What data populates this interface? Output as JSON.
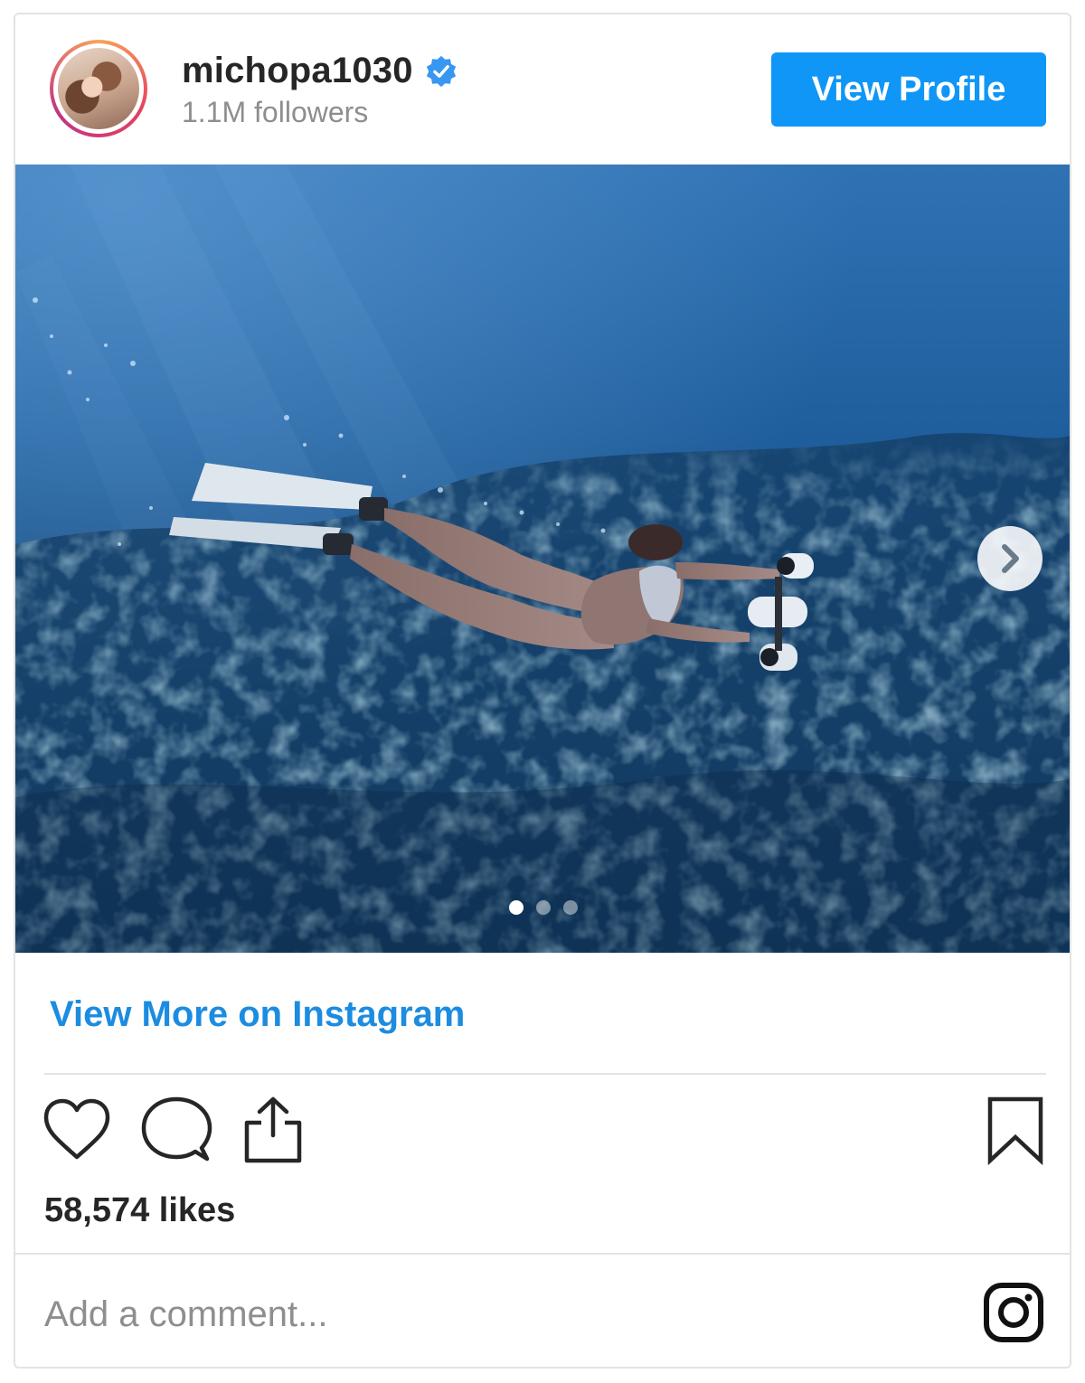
{
  "post": {
    "username": "michopa1030",
    "followers": "1.1M followers",
    "view_profile_label": "View Profile",
    "view_more_label": "View More on Instagram",
    "likes": "58,574 likes",
    "comment_placeholder": "Add a comment...",
    "carousel": {
      "slide_count": 3,
      "active_slide": 1
    }
  },
  "icons": {
    "verified": "verified-badge-icon",
    "next": "chevron-right-icon",
    "like": "heart-icon",
    "comment": "comment-bubble-icon",
    "share": "share-icon",
    "save": "bookmark-icon",
    "logo": "instagram-logo-icon"
  },
  "colors": {
    "accent": "#0f96f6",
    "link": "#1c8ce0",
    "text": "#262626",
    "muted": "#8e8e8e",
    "divider": "#e3e3e3"
  }
}
